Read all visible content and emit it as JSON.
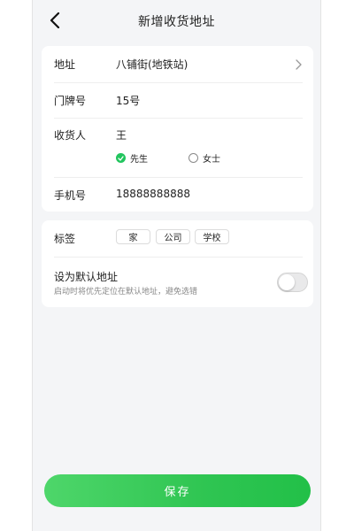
{
  "header": {
    "title": "新增收货地址"
  },
  "form": {
    "address": {
      "label": "地址",
      "value": "八铺街(地铁站)"
    },
    "door": {
      "label": "门牌号",
      "value": "15号"
    },
    "recipient": {
      "label": "收货人",
      "value": "王",
      "options": [
        {
          "label": "先生",
          "selected": true
        },
        {
          "label": "女士",
          "selected": false
        }
      ]
    },
    "phone": {
      "label": "手机号",
      "value": "18888888888"
    }
  },
  "tags": {
    "label": "标签",
    "items": [
      "家",
      "公司",
      "学校"
    ]
  },
  "default_address": {
    "title": "设为默认地址",
    "subtitle": "启动时将优先定位在默认地址，避免选错",
    "enabled": false
  },
  "save_button": {
    "label": "保存"
  },
  "colors": {
    "accent": "#22c55e",
    "background": "#f4f5f7"
  }
}
